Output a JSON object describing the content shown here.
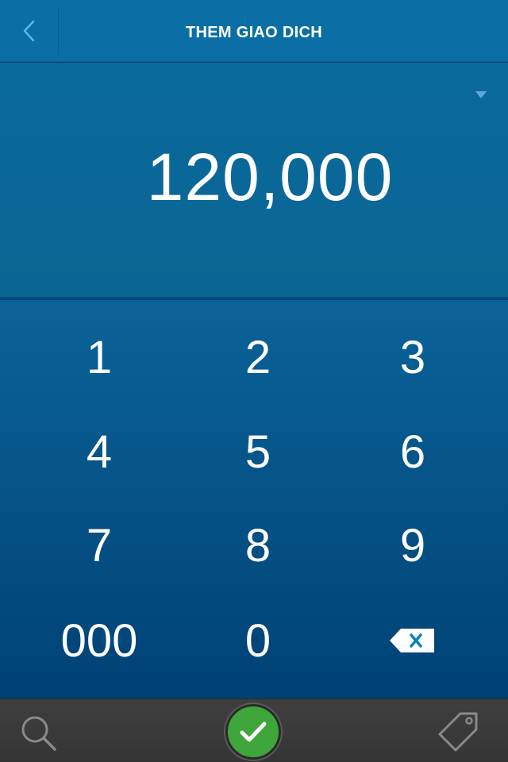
{
  "header": {
    "title": "THEM GIAO DICH",
    "back_icon": "chevron-left-icon"
  },
  "display": {
    "amount": "120,000",
    "dropdown_icon": "caret-down-icon"
  },
  "keypad": {
    "keys": [
      "1",
      "2",
      "3",
      "4",
      "5",
      "6",
      "7",
      "8",
      "9",
      "000",
      "0"
    ],
    "delete_icon": "backspace-icon"
  },
  "bottombar": {
    "search_icon": "search-icon",
    "confirm_icon": "checkmark-icon",
    "tag_icon": "tag-icon"
  },
  "colors": {
    "header_bg": "#0b6fa6",
    "keypad_top": "#0a6398",
    "keypad_bottom": "#004275",
    "bottombar_bg": "#3b3b3b",
    "confirm_green": "#3ea63a",
    "accent_blue": "#5bb8e6",
    "text": "#ffffff"
  }
}
